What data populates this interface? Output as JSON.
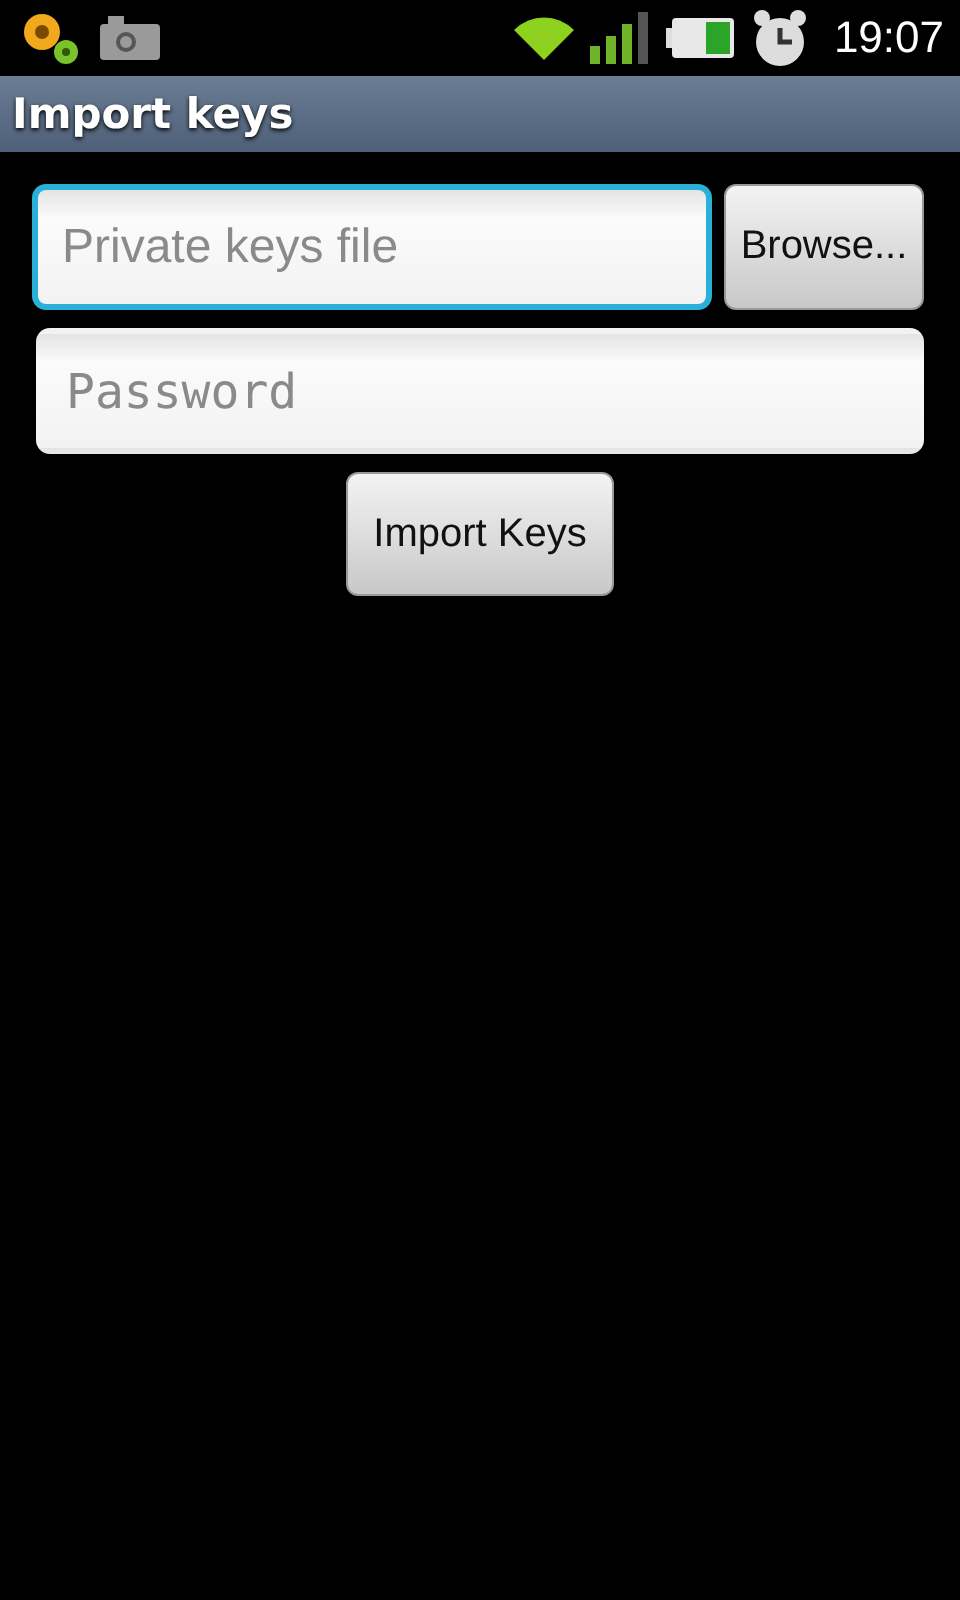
{
  "status_bar": {
    "time": "19:07"
  },
  "window": {
    "title": "Import keys"
  },
  "file_field": {
    "placeholder": "Private keys file",
    "focused": true
  },
  "browse_button": {
    "label": "Browse..."
  },
  "password_field": {
    "placeholder": "Password",
    "focused": false
  },
  "import_button": {
    "label": "Import Keys"
  }
}
